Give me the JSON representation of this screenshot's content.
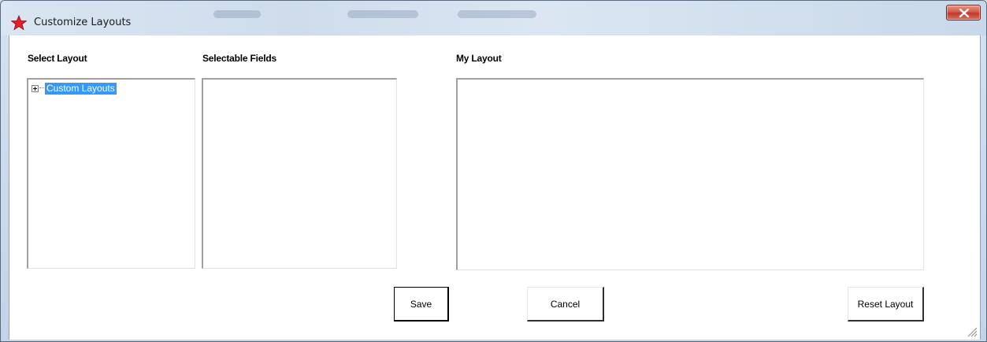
{
  "window": {
    "title": "Customize Layouts",
    "icon": "red-star-icon",
    "close_icon": "close-icon"
  },
  "select_layout": {
    "label": "Select Layout",
    "tree": [
      {
        "label": "Custom Layouts",
        "expanded": false,
        "selected": true
      }
    ]
  },
  "selectable_fields": {
    "label": "Selectable Fields",
    "items": []
  },
  "my_layout": {
    "label": "My Layout",
    "items": []
  },
  "buttons": {
    "save": "Save",
    "cancel": "Cancel",
    "reset": "Reset Layout"
  },
  "colors": {
    "selection": "#3399ff",
    "close_button": "#c0392b",
    "icon": "#e0202a"
  }
}
